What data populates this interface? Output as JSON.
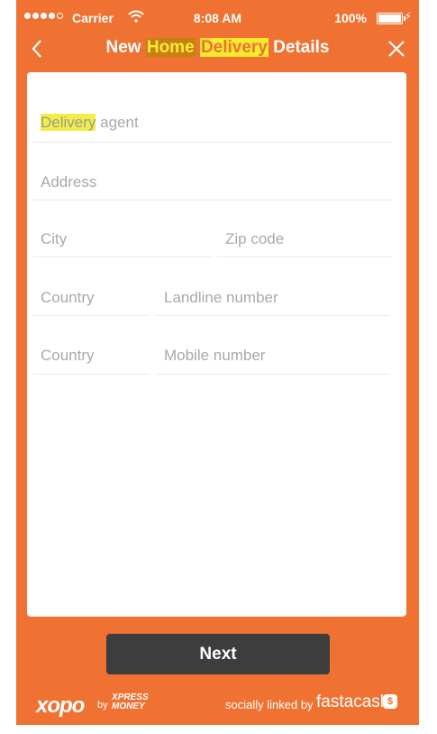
{
  "status_bar": {
    "carrier": "Carrier",
    "time": "8:08 AM",
    "battery": "100%"
  },
  "header": {
    "title_prefix": "New",
    "title_home": "Home",
    "title_delivery": "Delivery",
    "title_suffix": "Details"
  },
  "form": {
    "delivery_agent_highlight": "Delivery",
    "delivery_agent_rest": "agent",
    "address": "Address",
    "city": "City",
    "zip": "Zip code",
    "landline_country": "Country",
    "landline": "Landline number",
    "mobile_country": "Country",
    "mobile": "Mobile number"
  },
  "next_label": "Next",
  "footer": {
    "xopo": "xopo",
    "by": "by",
    "xpress_line1": "XPRESS",
    "xpress_line2": "MONEY",
    "socially": "socially linked by",
    "fastacash": "fastacash",
    "fc_badge": "$"
  },
  "colors": {
    "brand_orange": "#f07232",
    "button_dark": "#3d3d3d",
    "highlight_yellow": "#f5ea2e"
  }
}
